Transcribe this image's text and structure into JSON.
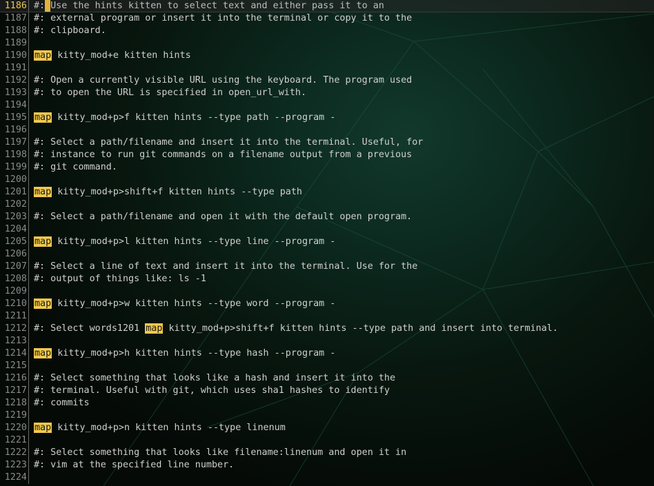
{
  "background": {
    "desc_colors": {
      "base": "#050a07",
      "glow": "#12392c",
      "terminal_text": "#2f9a5e"
    }
  },
  "editor": {
    "current_line_index": 0,
    "keyword_color": "#f2c94c",
    "lines": [
      {
        "n": "1186",
        "parts": [
          {
            "t": "c",
            "v": "#:"
          },
          {
            "t": "cursor"
          },
          {
            "t": "c",
            "v": "Use the hints kitten to select text and either pass it to an"
          }
        ]
      },
      {
        "n": "1187",
        "parts": [
          {
            "t": "c",
            "v": "#: external program or insert it into the terminal or copy it to the"
          }
        ]
      },
      {
        "n": "1188",
        "parts": [
          {
            "t": "c",
            "v": "#: clipboard."
          }
        ]
      },
      {
        "n": "1189",
        "parts": []
      },
      {
        "n": "1190",
        "parts": [
          {
            "t": "k",
            "v": "map"
          },
          {
            "t": "c",
            "v": " kitty_mod+e kitten hints"
          }
        ]
      },
      {
        "n": "1191",
        "parts": []
      },
      {
        "n": "1192",
        "parts": [
          {
            "t": "c",
            "v": "#: Open a currently visible URL using the keyboard. The program used"
          }
        ]
      },
      {
        "n": "1193",
        "parts": [
          {
            "t": "c",
            "v": "#: to open the URL is specified in open_url_with."
          }
        ]
      },
      {
        "n": "1194",
        "parts": []
      },
      {
        "n": "1195",
        "parts": [
          {
            "t": "k",
            "v": "map"
          },
          {
            "t": "c",
            "v": " kitty_mod+p>f kitten hints --type path --program -"
          }
        ]
      },
      {
        "n": "1196",
        "parts": []
      },
      {
        "n": "1197",
        "parts": [
          {
            "t": "c",
            "v": "#: Select a path/filename and insert it into the terminal. Useful, for"
          }
        ]
      },
      {
        "n": "1198",
        "parts": [
          {
            "t": "c",
            "v": "#: instance to run git commands on a filename output from a previous"
          }
        ]
      },
      {
        "n": "1199",
        "parts": [
          {
            "t": "c",
            "v": "#: git command."
          }
        ]
      },
      {
        "n": "1200",
        "parts": []
      },
      {
        "n": "1201",
        "parts": [
          {
            "t": "k",
            "v": "map"
          },
          {
            "t": "c",
            "v": " kitty_mod+p>shift+f kitten hints --type path"
          }
        ]
      },
      {
        "n": "1202",
        "parts": []
      },
      {
        "n": "1203",
        "parts": [
          {
            "t": "c",
            "v": "#: Select a path/filename and open it with the default open program."
          }
        ]
      },
      {
        "n": "1204",
        "parts": []
      },
      {
        "n": "1205",
        "parts": [
          {
            "t": "k",
            "v": "map"
          },
          {
            "t": "c",
            "v": " kitty_mod+p>l kitten hints --type line --program -"
          }
        ]
      },
      {
        "n": "1206",
        "parts": []
      },
      {
        "n": "1207",
        "parts": [
          {
            "t": "c",
            "v": "#: Select a line of text and insert it into the terminal. Use for the"
          }
        ]
      },
      {
        "n": "1208",
        "parts": [
          {
            "t": "c",
            "v": "#: output of things like: ls -1"
          }
        ]
      },
      {
        "n": "1209",
        "parts": []
      },
      {
        "n": "1210",
        "parts": [
          {
            "t": "k",
            "v": "map"
          },
          {
            "t": "c",
            "v": " kitty_mod+p>w kitten hints --type word --program -"
          }
        ]
      },
      {
        "n": "1211",
        "parts": []
      },
      {
        "n": "1212",
        "parts": [
          {
            "t": "c",
            "v": "#: Select words1201 "
          },
          {
            "t": "k",
            "v": "map"
          },
          {
            "t": "c",
            "v": " kitty_mod+p>shift+f kitten hints --type path and insert into terminal."
          }
        ]
      },
      {
        "n": "1213",
        "parts": []
      },
      {
        "n": "1214",
        "parts": [
          {
            "t": "k",
            "v": "map"
          },
          {
            "t": "c",
            "v": " kitty_mod+p>h kitten hints --type hash --program -"
          }
        ]
      },
      {
        "n": "1215",
        "parts": []
      },
      {
        "n": "1216",
        "parts": [
          {
            "t": "c",
            "v": "#: Select something that looks like a hash and insert it into the"
          }
        ]
      },
      {
        "n": "1217",
        "parts": [
          {
            "t": "c",
            "v": "#: terminal. Useful with git, which uses sha1 hashes to identify"
          }
        ]
      },
      {
        "n": "1218",
        "parts": [
          {
            "t": "c",
            "v": "#: commits"
          }
        ]
      },
      {
        "n": "1219",
        "parts": []
      },
      {
        "n": "1220",
        "parts": [
          {
            "t": "k",
            "v": "map"
          },
          {
            "t": "c",
            "v": " kitty_mod+p>n kitten hints --type linenum"
          }
        ]
      },
      {
        "n": "1221",
        "parts": []
      },
      {
        "n": "1222",
        "parts": [
          {
            "t": "c",
            "v": "#: Select something that looks like filename:linenum and open it in"
          }
        ]
      },
      {
        "n": "1223",
        "parts": [
          {
            "t": "c",
            "v": "#: vim at the specified line number."
          }
        ]
      },
      {
        "n": "1224",
        "parts": []
      }
    ]
  }
}
